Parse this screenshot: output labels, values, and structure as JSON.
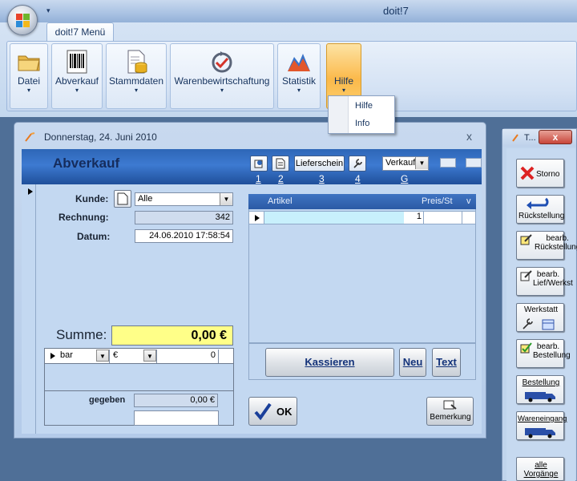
{
  "app": {
    "title": "doit!7",
    "qat_glyph": "▾"
  },
  "ribbon": {
    "tab_label": "doit!7 Menü",
    "groups": [
      {
        "label": "Datei",
        "icon": "folder-icon"
      },
      {
        "label": "Abverkauf",
        "icon": "barcode-icon"
      },
      {
        "label": "Stammdaten",
        "icon": "database-document-icon"
      },
      {
        "label": "Warenbewirtschaftung",
        "icon": "refresh-check-icon"
      },
      {
        "label": "Statistik",
        "icon": "mountain-chart-icon"
      },
      {
        "label": "Hilfe",
        "icon": "",
        "active": true
      }
    ],
    "dropdown_arrow": "▾"
  },
  "menu": {
    "items": [
      "Hilfe",
      "Info"
    ]
  },
  "window": {
    "title": "Donnerstag, 24. Juni 2010",
    "close": "x",
    "header_title": "Abverkauf",
    "toolbar": {
      "lieferschein": "Lieferschein",
      "numbers": [
        "1",
        "2",
        "3",
        "4"
      ],
      "mode_value": "Verkauf",
      "mode_hotkey": "G"
    },
    "form": {
      "kunde_label": "Kunde:",
      "kunde_value": "Alle",
      "rechnung_label": "Rechnung:",
      "rechnung_value": "342",
      "datum_label": "Datum:",
      "datum_value": "24.06.2010 17:58:54"
    },
    "summe": {
      "label": "Summe:",
      "value": "0,00 €"
    },
    "payment": {
      "method": "bar",
      "currency": "€",
      "amount": "0",
      "gegeben_label": "gegeben",
      "gegeben_value": "0,00 €",
      "extra_value": ""
    },
    "grid": {
      "columns": [
        "Artikel",
        "Preis/St",
        "v"
      ],
      "rows": [
        {
          "artikel": "",
          "qty": "1",
          "preis": "",
          "v": ""
        }
      ]
    },
    "buttons": {
      "kassieren": "Kassieren",
      "neu": "Neu",
      "text": "Text",
      "ok": "OK",
      "bemerkung": "Bemerkung"
    }
  },
  "side_panel": {
    "title": "T...",
    "close": "x",
    "buttons": [
      {
        "label": "Storno",
        "icon": "red-x-icon"
      },
      {
        "label": "Rückstellung",
        "icon": "blue-arrows-icon"
      },
      {
        "label": "bearb. Rückstellung",
        "icon": "edit-pencil-icon"
      },
      {
        "label": "bearb. Lief/Werkst",
        "icon": "edit-pencil-icon"
      },
      {
        "label": "Werkstatt",
        "icon": "wrench-calendar-icon"
      },
      {
        "label": "bearb. Bestellung",
        "icon": "edit-check-icon"
      },
      {
        "label": "Bestellung",
        "icon": "truck-icon"
      },
      {
        "label": "Wareneingang",
        "icon": "truck-icon"
      },
      {
        "label": "alle Vorgänge",
        "icon": ""
      }
    ]
  }
}
